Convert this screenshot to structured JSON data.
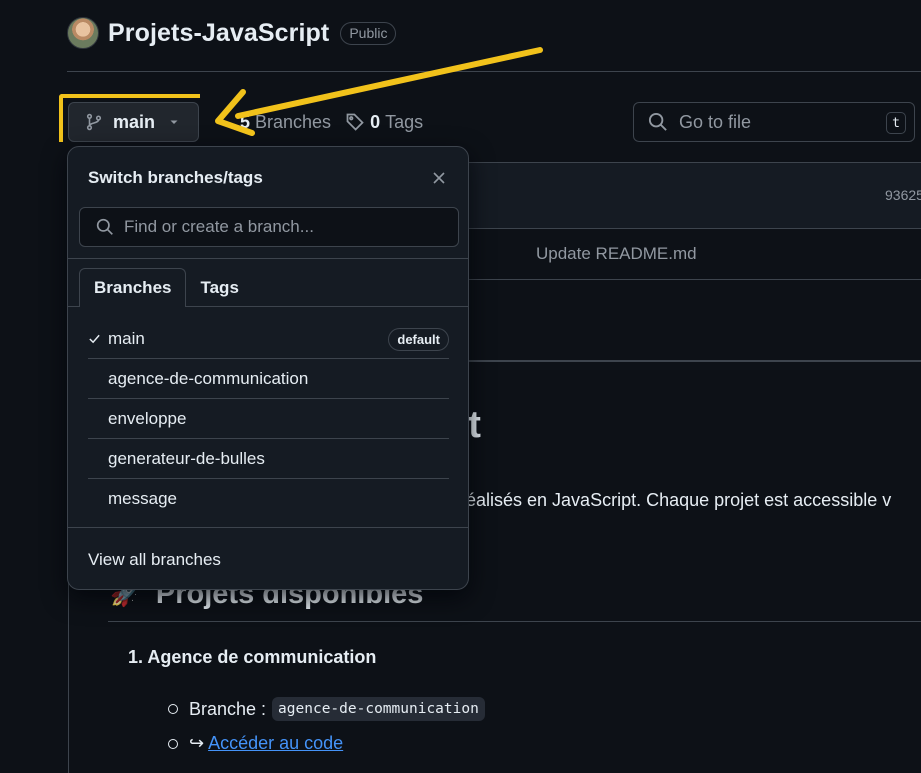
{
  "repo": {
    "name": "Projets-JavaScript",
    "visibility": "Public"
  },
  "toolbar": {
    "branch": "main",
    "branches_count": "5",
    "branches_label": "Branches",
    "tags_count": "0",
    "tags_label": "Tags",
    "goto_file_placeholder": "Go to file",
    "goto_file_shortcut": "t"
  },
  "files": {
    "commit_hash_fragment": "93625",
    "commit_message": "Update README.md"
  },
  "readme": {
    "title_fragment": "pt",
    "paragraph_fragment": "réalisés en JavaScript. Chaque projet est accessible v",
    "section_emoji": "🚀",
    "section_title": "Projets disponibles",
    "project_title": "1. Agence de communication",
    "branch_label": "Branche :",
    "branch_code": "agence-de-communication",
    "link_icon": "↪",
    "link_text": "Accéder au code"
  },
  "dropdown": {
    "title": "Switch branches/tags",
    "search_placeholder": "Find or create a branch...",
    "tabs": [
      "Branches",
      "Tags"
    ],
    "branches": [
      {
        "name": "main",
        "selected": true,
        "badge": "default"
      },
      {
        "name": "agence-de-communication",
        "selected": false,
        "badge": ""
      },
      {
        "name": "enveloppe",
        "selected": false,
        "badge": ""
      },
      {
        "name": "generateur-de-bulles",
        "selected": false,
        "badge": ""
      },
      {
        "name": "message",
        "selected": false,
        "badge": ""
      }
    ],
    "footer_link": "View all branches"
  },
  "colors": {
    "background": "#0d1117",
    "panel": "#151b23",
    "border": "#3d444d",
    "text": "#e6edf3",
    "muted": "#9198a1",
    "link": "#4493f8",
    "annotation": "#f1c21b"
  }
}
